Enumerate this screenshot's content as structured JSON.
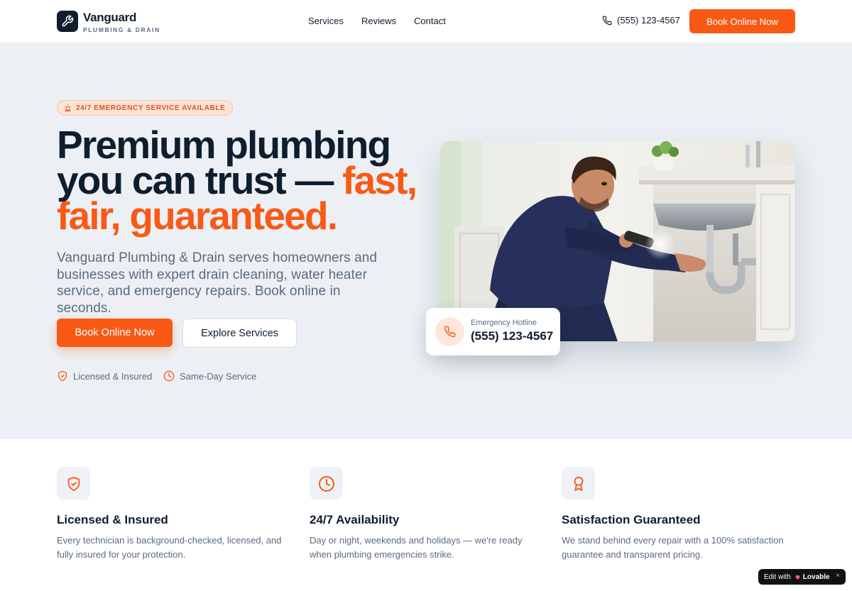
{
  "header": {
    "brand_name": "Vanguard",
    "brand_tagline": "PLUMBING & DRAIN",
    "nav": [
      {
        "label": "Services"
      },
      {
        "label": "Reviews"
      },
      {
        "label": "Contact"
      }
    ],
    "phone": "(555) 123-4567",
    "cta_label": "Book Online Now"
  },
  "hero": {
    "badge": "24/7 EMERGENCY SERVICE AVAILABLE",
    "headline_part1": "Premium plumbing you can trust — ",
    "headline_part2": "fast, fair, guaranteed.",
    "description": "Vanguard Plumbing & Drain serves homeowners and businesses with expert drain cleaning, water heater service, and emergency repairs. Book online in seconds.",
    "primary_cta": "Book Online Now",
    "secondary_cta": "Explore Services",
    "trust": [
      {
        "label": "Licensed & Insured",
        "icon": "shield-check-icon"
      },
      {
        "label": "Same-Day Service",
        "icon": "clock-icon"
      }
    ],
    "hotline": {
      "label": "Emergency Hotline",
      "number": "(555) 123-4567"
    }
  },
  "features": [
    {
      "title": "Licensed & Insured",
      "description": "Every technician is background-checked, licensed, and fully insured for your protection.",
      "icon": "shield-check-icon"
    },
    {
      "title": "24/7 Availability",
      "description": "Day or night, weekends and holidays — we're ready when plumbing emergencies strike.",
      "icon": "clock-icon"
    },
    {
      "title": "Satisfaction Guaranteed",
      "description": "We stand behind every repair with a 100% satisfaction guarantee and transparent pricing.",
      "icon": "award-icon"
    }
  ],
  "lovable_badge": {
    "prefix": "Edit with",
    "brand": "Lovable",
    "close": "×"
  },
  "colors": {
    "accent": "#f85a15",
    "navy": "#0f1e2e",
    "muted": "#5a6b7e",
    "hero_bg": "#ecf0f5"
  }
}
